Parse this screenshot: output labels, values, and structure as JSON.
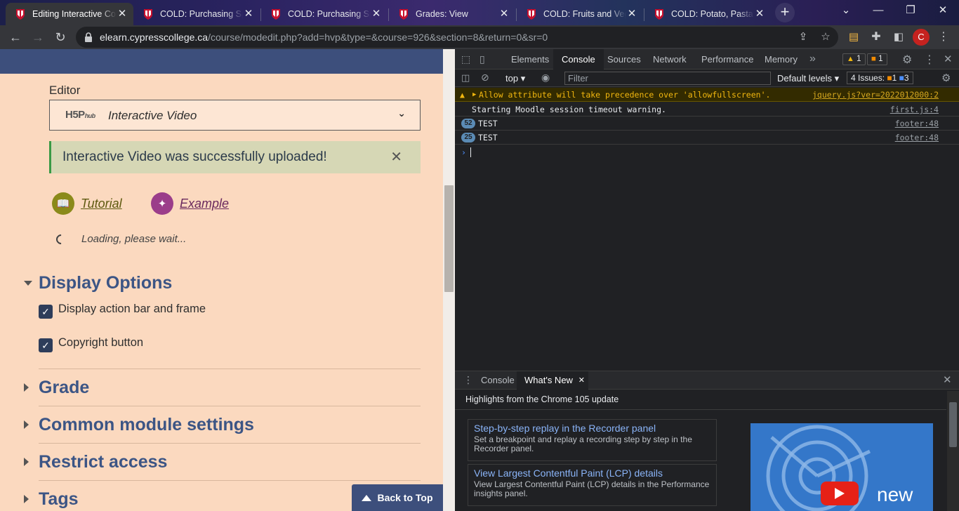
{
  "browser": {
    "tabs": [
      {
        "title": "Editing Interactive Co",
        "active": true
      },
      {
        "title": "COLD: Purchasing Spe",
        "active": false
      },
      {
        "title": "COLD: Purchasing Spe",
        "active": false
      },
      {
        "title": "Grades: View",
        "active": false
      },
      {
        "title": "COLD: Fruits and Vege",
        "active": false
      },
      {
        "title": "COLD: Potato, Pasta ar",
        "active": false
      }
    ],
    "tab_close_glyph": "✕",
    "new_tab_glyph": "+",
    "url_domain": "elearn.cypresscollege.ca",
    "url_path": "/course/modedit.php?add=hvp&type=&course=926&section=8&return=0&sr=0",
    "profile_initial": "C"
  },
  "page": {
    "editor_label": "Editor",
    "editor_select": {
      "logo_text": "H5P",
      "logo_sub": "hub",
      "value": "Interactive Video"
    },
    "alert_message": "Interactive Video was successfully uploaded!",
    "tutorial_link": "Tutorial",
    "example_link": "Example",
    "loading_text": "Loading, please wait...",
    "display_options": {
      "heading": "Display Options",
      "options": [
        {
          "label": "Display action bar and frame",
          "checked": true
        },
        {
          "label": "Copyright button",
          "checked": true
        }
      ]
    },
    "collapsed_sections": [
      "Grade",
      "Common module settings",
      "Restrict access",
      "Tags"
    ],
    "back_to_top": "Back to Top"
  },
  "devtools": {
    "tabs": [
      "Elements",
      "Console",
      "Sources",
      "Network",
      "Performance",
      "Memory"
    ],
    "active_tab": "Console",
    "more_glyph": "»",
    "warning_count": "1",
    "issue_count": "1",
    "context": "top",
    "filter_placeholder": "Filter",
    "levels": "Default levels",
    "issues": {
      "label": "4 Issues:",
      "warnings": "1",
      "messages": "3"
    },
    "console": [
      {
        "text": "Allow attribute will take precedence over 'allowfullscreen'.",
        "source": "jquery.js?ver=2022012000:2",
        "level": "warning"
      },
      {
        "text": "Starting Moodle session timeout warning.",
        "source": "first.js:4",
        "level": "info"
      },
      {
        "text": "TEST",
        "source": "footer:48",
        "count": "52",
        "level": "info"
      },
      {
        "text": "TEST",
        "source": "footer:48",
        "count": "25",
        "level": "info"
      }
    ],
    "prompt": "›",
    "drawer_tabs": [
      "Console",
      "What's New"
    ],
    "whatsnew": {
      "heading": "Highlights from the Chrome 105 update",
      "items": [
        {
          "title": "Step-by-step replay in the Recorder panel",
          "desc": "Set a breakpoint and replay a recording step by step in the Recorder panel."
        },
        {
          "title": "View Largest Contentful Paint (LCP) details",
          "desc": "View Largest Contentful Paint (LCP) details in the Performance insights panel."
        }
      ],
      "video_text": "new"
    }
  },
  "colors": {
    "page_bg": "#fbd9bf",
    "moodle_blue": "#3d4f7c",
    "heading_blue": "#3c5585",
    "success_border": "#3a9a45",
    "tutorial_olive": "#8a8a1a",
    "example_purple": "#9b3d8a"
  }
}
